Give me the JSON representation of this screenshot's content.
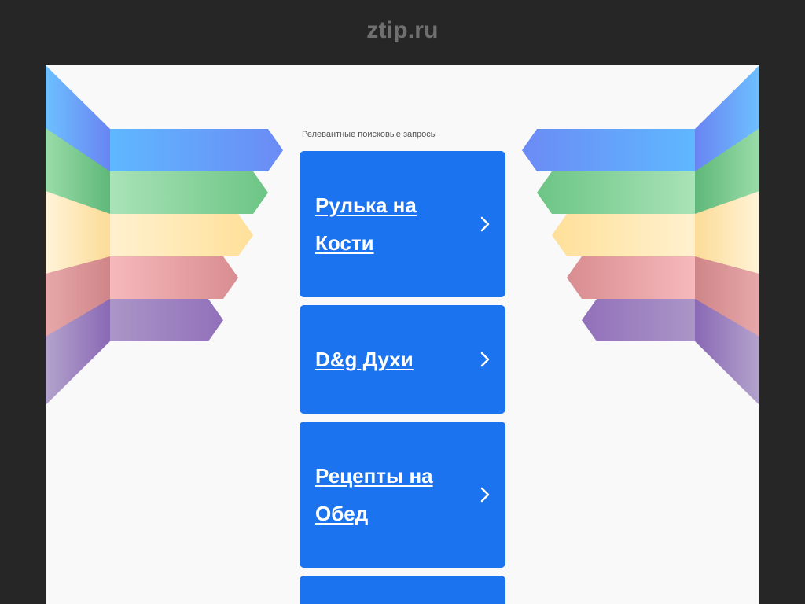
{
  "header": {
    "site_title": "ztip.ru"
  },
  "related": {
    "label": "Релевантные поисковые запросы",
    "items": [
      {
        "label": "Рулька на Кости"
      },
      {
        "label": "D&g Духи"
      },
      {
        "label": "Рецепты на Обед"
      },
      {
        "label": ""
      }
    ]
  },
  "colors": {
    "background": "#262626",
    "panel": "#f9f9f9",
    "card": "#1b73ef",
    "wing_blue": "#5fb8ff",
    "wing_green": "#6cc585",
    "wing_yellow": "#ffe4a3",
    "wing_red": "#d98d90",
    "wing_purple": "#9872bb"
  },
  "icons": {
    "card_arrow": "chevron-right-icon"
  }
}
